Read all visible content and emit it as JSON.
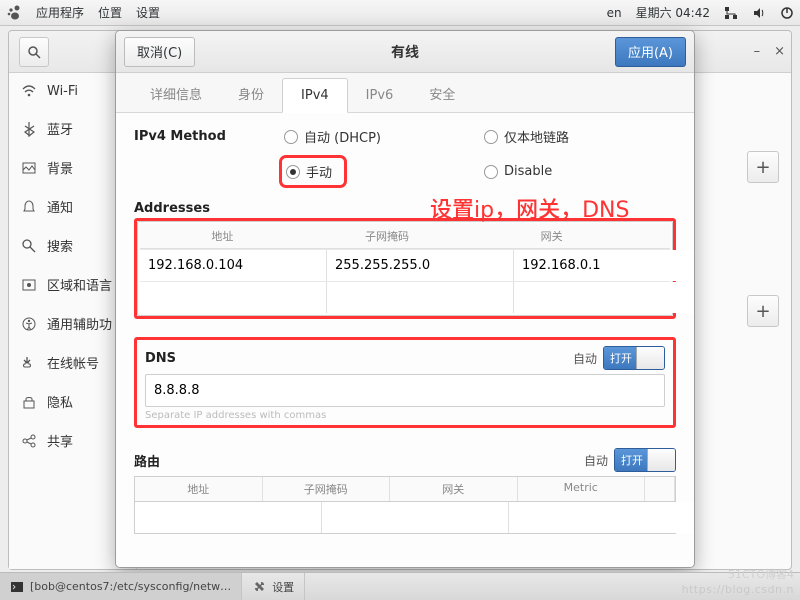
{
  "topbar": {
    "menu_apps": "应用程序",
    "menu_places": "位置",
    "menu_settings": "设置",
    "lang": "en",
    "clock": "星期六 04:42"
  },
  "settings_window": {
    "minimize": "–",
    "close": "×"
  },
  "sidebar": {
    "items": [
      {
        "label": "Wi-Fi"
      },
      {
        "label": "蓝牙"
      },
      {
        "label": "背景"
      },
      {
        "label": "通知"
      },
      {
        "label": "搜索"
      },
      {
        "label": "区域和语言"
      },
      {
        "label": "通用辅助功"
      },
      {
        "label": "在线帐号"
      },
      {
        "label": "隐私"
      },
      {
        "label": "共享"
      }
    ]
  },
  "dialog": {
    "cancel": "取消(C)",
    "title": "有线",
    "apply": "应用(A)",
    "tabs": {
      "details": "详细信息",
      "identity": "身份",
      "ipv4": "IPv4",
      "ipv6": "IPv6",
      "security": "安全"
    },
    "method_label": "IPv4 Method",
    "methods": {
      "auto": "自动 (DHCP)",
      "local": "仅本地链路",
      "manual": "手动",
      "disable": "Disable"
    },
    "addresses_title": "Addresses",
    "addr_cols": {
      "addr": "地址",
      "mask": "子网掩码",
      "gw": "网关"
    },
    "row1": {
      "addr": "192.168.0.104",
      "mask": "255.255.255.0",
      "gw": "192.168.0.1"
    },
    "dns_title": "DNS",
    "auto_label": "自动",
    "switch_on": "打开",
    "dns_value": "8.8.8.8",
    "dns_hint": "Separate IP addresses with commas",
    "routes_title": "路由",
    "route_cols": {
      "addr": "地址",
      "mask": "子网掩码",
      "gw": "网关",
      "metric": "Metric"
    }
  },
  "annotation": "设置ip，网关，DNS",
  "taskbar": {
    "terminal": "[bob@centos7:/etc/sysconfig/netw…",
    "settings": "设置"
  },
  "watermark": "https://blog.csdn.n",
  "watermark2": "51CTO博客4"
}
